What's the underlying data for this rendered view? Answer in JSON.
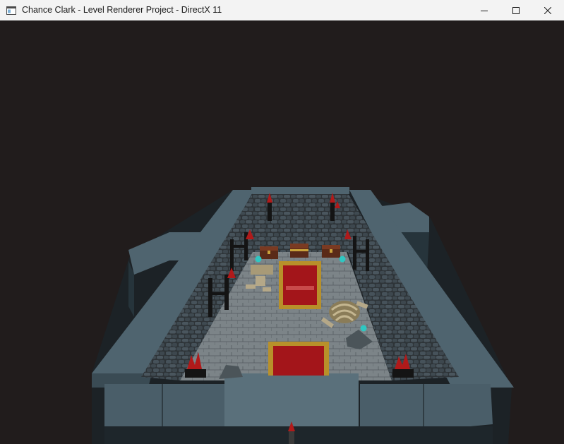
{
  "window": {
    "title": "Chance Clark - Level Renderer Project - DirectX 11",
    "app_icon": "window-app-icon",
    "controls": [
      "minimize-icon",
      "maximize-icon",
      "close-icon"
    ]
  },
  "viewport": {
    "background_color": "#211c1c",
    "scene": "dungeon-room",
    "colors": {
      "wall_stone": "#3a4146",
      "cap_stone": "#4f646f",
      "floor": "#7a8287",
      "carpet_red": "#a3151a",
      "carpet_gold": "#b8902a",
      "chest_wood": "#5a2a18",
      "torch_flame": "#b01a1a",
      "bone": "#b5a888",
      "potion": "#2fc7c2"
    }
  }
}
